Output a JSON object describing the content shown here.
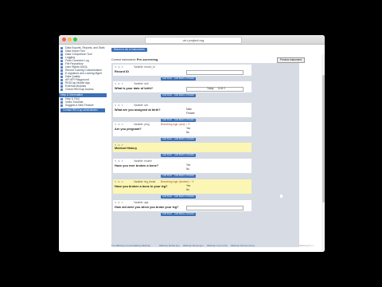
{
  "browser": {
    "url": "uri.r.project.org"
  },
  "sidebar": {
    "items": [
      "Data Exports, Reports, and Stats",
      "Data Import Tool",
      "Data Comparison Tool",
      "Logging",
      "Field Comment Log",
      "File Repository",
      "User Rights  DAGs",
      "Record Locking Customization",
      "E-signature and Locking Mgmt",
      "Data Quality",
      "API  API Playground",
      "REDCap Mobile App",
      "External Modules",
      "Check REDCap Access"
    ],
    "help_header": "Help & Information",
    "help_items": [
      "Help & FAQ",
      "Video Tutorials",
      "Suggest a New Feature"
    ],
    "contact_button": "Contact REDCap administrator"
  },
  "main": {
    "back_button": "Return to list of instruments",
    "instrument_label": "Current instrument:",
    "instrument_name": "Pre-screening",
    "preview_button": "Preview instrument",
    "blocks": [
      {
        "id": "b1",
        "type": "field",
        "var": "Variable: record_id",
        "question": "Record ID"
      },
      {
        "id": "b2",
        "type": "field",
        "var": "Variable: dob",
        "question": "What is your date of birth?",
        "btn1": "Add Field",
        "btn2": "Add Matrix of Fields",
        "extra": "Today",
        "extra2": "D-M-Y"
      },
      {
        "id": "b3",
        "type": "field",
        "var": "Variable: sex",
        "question": "What are you assigned at birth?",
        "opts": [
          "Male",
          "Female"
        ]
      },
      {
        "id": "b4",
        "type": "field",
        "var": "Variable: preg",
        "note": "Branching logic: [sex] = '2'",
        "question": "Are you pregnant?",
        "opts": [
          "Yes",
          "No"
        ]
      },
      {
        "id": "b5",
        "type": "section",
        "question": "Medical History"
      },
      {
        "id": "b6",
        "type": "field",
        "var": "Variable: broken",
        "question": "Have you ever broken a bone?",
        "opts": [
          "Yes",
          "No"
        ]
      },
      {
        "id": "b7",
        "type": "field",
        "var": "Variable: leg_break",
        "note": "Branching logic: [broken] = '1'",
        "question": "Have you broken a bone in your leg?",
        "opts": [
          "Yes",
          "No"
        ]
      },
      {
        "id": "b8",
        "type": "field",
        "var": "Variable: age",
        "question": "How old were you when you broke your leg?"
      }
    ],
    "add_field": "Add Field",
    "add_matrix": "Add Matrix of Fields"
  },
  "footer": {
    "links": [
      "The REDCap Consortium",
      "Citing REDCap",
      "REDCap Mobile App",
      "REDCap Messenger",
      "REDCap Community",
      "REDCap Shared Library"
    ],
    "version": "REDCap 8.x.x"
  }
}
